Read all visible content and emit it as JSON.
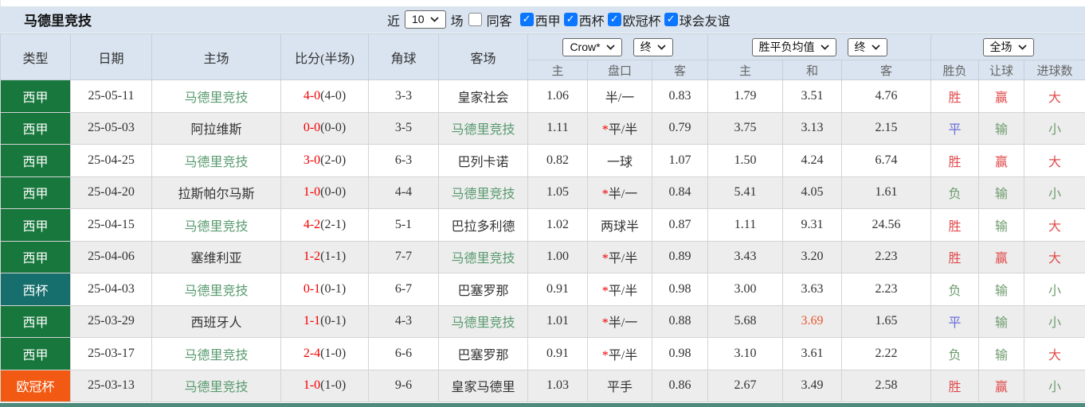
{
  "topbar": {
    "title": "马德里竞技",
    "recent_label": "近",
    "recent_value": "10",
    "matches_label": "场",
    "same_opponent_label": "同客",
    "filters": [
      {
        "label": "西甲",
        "checked": true
      },
      {
        "label": "西杯",
        "checked": true
      },
      {
        "label": "欧冠杯",
        "checked": true
      },
      {
        "label": "球会友谊",
        "checked": true
      }
    ]
  },
  "colors": {
    "liga_badge": "#17773c",
    "cup_badge": "#166f6d",
    "ucl_badge": "#f25a13",
    "header_bg": "#d9e4f0",
    "odds_bg": "#faf5e9",
    "avg_bg": "#e9f2f9",
    "win_red": "#e14b4b",
    "lose_green": "#6f9c6f",
    "draw_blue": "#6a6fd8",
    "team_green": "#589a6e",
    "score_red": "#f20000",
    "highlight_orange": "#e8552d",
    "checkbox_blue": "#0b76ff"
  },
  "table": {
    "columns": {
      "type": "类型",
      "date": "日期",
      "home": "主场",
      "score": "比分(半场)",
      "corners": "角球",
      "away": "客场"
    },
    "odds_group": {
      "bookmaker": "Crow*",
      "stage": "终",
      "sub": [
        "主",
        "盘口",
        "客"
      ]
    },
    "avg_group": {
      "name": "胜平负均值",
      "stage": "终",
      "sub": [
        "主",
        "和",
        "客"
      ]
    },
    "result_group": {
      "scope": "全场",
      "sub": [
        "胜负",
        "让球",
        "进球数"
      ]
    },
    "rows": [
      {
        "type": "西甲",
        "type_cls": "liga",
        "date": "25-05-11",
        "home": "马德里竞技",
        "home_main": true,
        "score_ft": "4-0",
        "score_ht": "(4-0)",
        "corners": "3-3",
        "away": "皇家社会",
        "away_main": false,
        "odds_home": "1.06",
        "handicap": "半/一",
        "handicap_star": false,
        "odds_away": "0.83",
        "avg_home": "1.79",
        "avg_draw": "3.51",
        "avg_draw_hl": false,
        "avg_away": "4.76",
        "result": "胜",
        "result_cls": "red",
        "spread": "赢",
        "spread_cls": "red",
        "goals": "大",
        "goals_cls": "red"
      },
      {
        "type": "西甲",
        "type_cls": "liga",
        "date": "25-05-03",
        "home": "阿拉维斯",
        "home_main": false,
        "score_ft": "0-0",
        "score_ht": "(0-0)",
        "corners": "3-5",
        "away": "马德里竞技",
        "away_main": true,
        "odds_home": "1.11",
        "handicap": "平/半",
        "handicap_star": true,
        "odds_away": "0.79",
        "avg_home": "3.75",
        "avg_draw": "3.13",
        "avg_draw_hl": false,
        "avg_away": "2.15",
        "result": "平",
        "result_cls": "blue",
        "spread": "输",
        "spread_cls": "green",
        "goals": "小",
        "goals_cls": "green"
      },
      {
        "type": "西甲",
        "type_cls": "liga",
        "date": "25-04-25",
        "home": "马德里竞技",
        "home_main": true,
        "score_ft": "3-0",
        "score_ht": "(2-0)",
        "corners": "6-3",
        "away": "巴列卡诺",
        "away_main": false,
        "odds_home": "0.82",
        "handicap": "一球",
        "handicap_star": false,
        "odds_away": "1.07",
        "avg_home": "1.50",
        "avg_draw": "4.24",
        "avg_draw_hl": false,
        "avg_away": "6.74",
        "result": "胜",
        "result_cls": "red",
        "spread": "赢",
        "spread_cls": "red",
        "goals": "大",
        "goals_cls": "red"
      },
      {
        "type": "西甲",
        "type_cls": "liga",
        "date": "25-04-20",
        "home": "拉斯帕尔马斯",
        "home_main": false,
        "score_ft": "1-0",
        "score_ht": "(0-0)",
        "corners": "4-4",
        "away": "马德里竞技",
        "away_main": true,
        "odds_home": "1.05",
        "handicap": "半/一",
        "handicap_star": true,
        "odds_away": "0.84",
        "avg_home": "5.41",
        "avg_draw": "4.05",
        "avg_draw_hl": false,
        "avg_away": "1.61",
        "result": "负",
        "result_cls": "green",
        "spread": "输",
        "spread_cls": "green",
        "goals": "小",
        "goals_cls": "green"
      },
      {
        "type": "西甲",
        "type_cls": "liga",
        "date": "25-04-15",
        "home": "马德里竞技",
        "home_main": true,
        "score_ft": "4-2",
        "score_ht": "(2-1)",
        "corners": "5-1",
        "away": "巴拉多利德",
        "away_main": false,
        "odds_home": "1.02",
        "handicap": "两球半",
        "handicap_star": false,
        "odds_away": "0.87",
        "avg_home": "1.11",
        "avg_draw": "9.31",
        "avg_draw_hl": false,
        "avg_away": "24.56",
        "result": "胜",
        "result_cls": "red",
        "spread": "输",
        "spread_cls": "green",
        "goals": "大",
        "goals_cls": "red"
      },
      {
        "type": "西甲",
        "type_cls": "liga",
        "date": "25-04-06",
        "home": "塞维利亚",
        "home_main": false,
        "score_ft": "1-2",
        "score_ht": "(1-1)",
        "corners": "7-7",
        "away": "马德里竞技",
        "away_main": true,
        "odds_home": "1.00",
        "handicap": "平/半",
        "handicap_star": true,
        "odds_away": "0.89",
        "avg_home": "3.43",
        "avg_draw": "3.20",
        "avg_draw_hl": false,
        "avg_away": "2.23",
        "result": "胜",
        "result_cls": "red",
        "spread": "赢",
        "spread_cls": "red",
        "goals": "大",
        "goals_cls": "red"
      },
      {
        "type": "西杯",
        "type_cls": "cup",
        "date": "25-04-03",
        "home": "马德里竞技",
        "home_main": true,
        "score_ft": "0-1",
        "score_ht": "(0-1)",
        "corners": "6-7",
        "away": "巴塞罗那",
        "away_main": false,
        "odds_home": "0.91",
        "handicap": "平/半",
        "handicap_star": true,
        "odds_away": "0.98",
        "avg_home": "3.00",
        "avg_draw": "3.63",
        "avg_draw_hl": false,
        "avg_away": "2.23",
        "result": "负",
        "result_cls": "green",
        "spread": "输",
        "spread_cls": "green",
        "goals": "小",
        "goals_cls": "green"
      },
      {
        "type": "西甲",
        "type_cls": "liga",
        "date": "25-03-29",
        "home": "西班牙人",
        "home_main": false,
        "score_ft": "1-1",
        "score_ht": "(0-1)",
        "corners": "4-3",
        "away": "马德里竞技",
        "away_main": true,
        "odds_home": "1.01",
        "handicap": "半/一",
        "handicap_star": true,
        "odds_away": "0.88",
        "avg_home": "5.68",
        "avg_draw": "3.69",
        "avg_draw_hl": true,
        "avg_away": "1.65",
        "result": "平",
        "result_cls": "blue",
        "spread": "输",
        "spread_cls": "green",
        "goals": "小",
        "goals_cls": "green"
      },
      {
        "type": "西甲",
        "type_cls": "liga",
        "date": "25-03-17",
        "home": "马德里竞技",
        "home_main": true,
        "score_ft": "2-4",
        "score_ht": "(1-0)",
        "corners": "6-6",
        "away": "巴塞罗那",
        "away_main": false,
        "odds_home": "0.91",
        "handicap": "平/半",
        "handicap_star": true,
        "odds_away": "0.98",
        "avg_home": "3.10",
        "avg_draw": "3.61",
        "avg_draw_hl": false,
        "avg_away": "2.22",
        "result": "负",
        "result_cls": "green",
        "spread": "输",
        "spread_cls": "green",
        "goals": "大",
        "goals_cls": "red"
      },
      {
        "type": "欧冠杯",
        "type_cls": "ucl",
        "date": "25-03-13",
        "home": "马德里竞技",
        "home_main": true,
        "score_ft": "1-0",
        "score_ht": "(1-0)",
        "corners": "9-6",
        "away": "皇家马德里",
        "away_main": false,
        "odds_home": "1.03",
        "handicap": "平手",
        "handicap_star": false,
        "odds_away": "0.86",
        "avg_home": "2.67",
        "avg_draw": "3.49",
        "avg_draw_hl": false,
        "avg_away": "2.58",
        "result": "胜",
        "result_cls": "red",
        "spread": "赢",
        "spread_cls": "red",
        "goals": "小",
        "goals_cls": "green"
      }
    ]
  }
}
